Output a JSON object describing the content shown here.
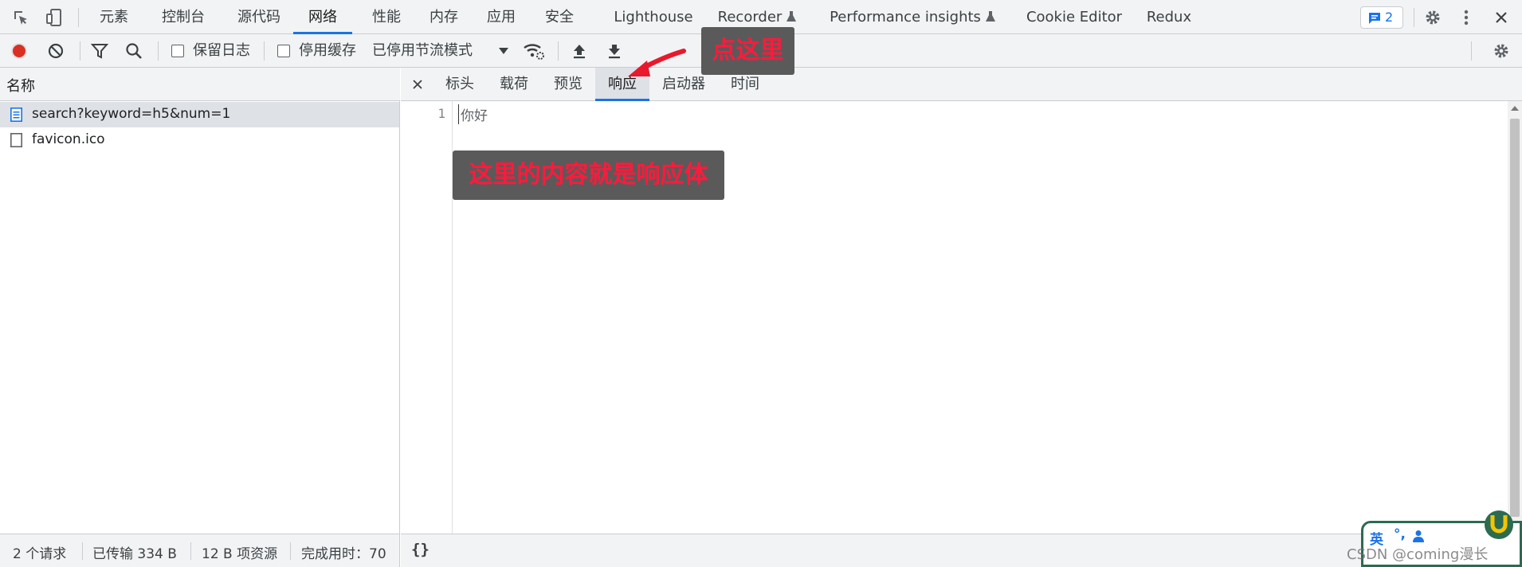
{
  "devtools": {
    "panel_tabs": [
      {
        "label": "元素"
      },
      {
        "label": "控制台"
      },
      {
        "label": "源代码"
      },
      {
        "label": "网络",
        "active": true
      },
      {
        "label": "性能"
      },
      {
        "label": "内存"
      },
      {
        "label": "应用"
      },
      {
        "label": "安全"
      },
      {
        "label": "Lighthouse"
      },
      {
        "label": "Recorder",
        "experimental": true
      },
      {
        "label": "Performance insights",
        "experimental": true
      },
      {
        "label": "Cookie Editor"
      },
      {
        "label": "Redux"
      }
    ],
    "issues_count": "2",
    "accent_color": "#1a73e8",
    "record_color": "#d93025"
  },
  "network_toolbar": {
    "preserve_log_label": "保留日志",
    "preserve_log_checked": false,
    "disable_cache_label": "停用缓存",
    "disable_cache_checked": false,
    "throttling_label": "已停用节流模式"
  },
  "request_list": {
    "header": "名称",
    "rows": [
      {
        "name": "search?keyword=h5&num=1",
        "selected": true,
        "icon": "document-icon"
      },
      {
        "name": "favicon.ico",
        "selected": false,
        "icon": "file-icon"
      }
    ]
  },
  "detail": {
    "tabs": [
      {
        "label": "标头"
      },
      {
        "label": "载荷"
      },
      {
        "label": "预览"
      },
      {
        "label": "响应",
        "active": true
      },
      {
        "label": "启动器"
      },
      {
        "label": "时间"
      }
    ],
    "response": {
      "line_number": "1",
      "content": "你好"
    },
    "pretty_print_label": "{}"
  },
  "status_bar": {
    "requests": "2 个请求",
    "transferred": "已传输 334 B",
    "resources": "12 B 项资源",
    "finish": "完成用时：70"
  },
  "annotations": {
    "callout_tab": "点这里",
    "callout_body": "这里的内容就是响应体",
    "color": "#ff1a3c"
  },
  "ime": {
    "lang": "英",
    "punct": "°,"
  },
  "watermark": "CSDN @coming漫长"
}
